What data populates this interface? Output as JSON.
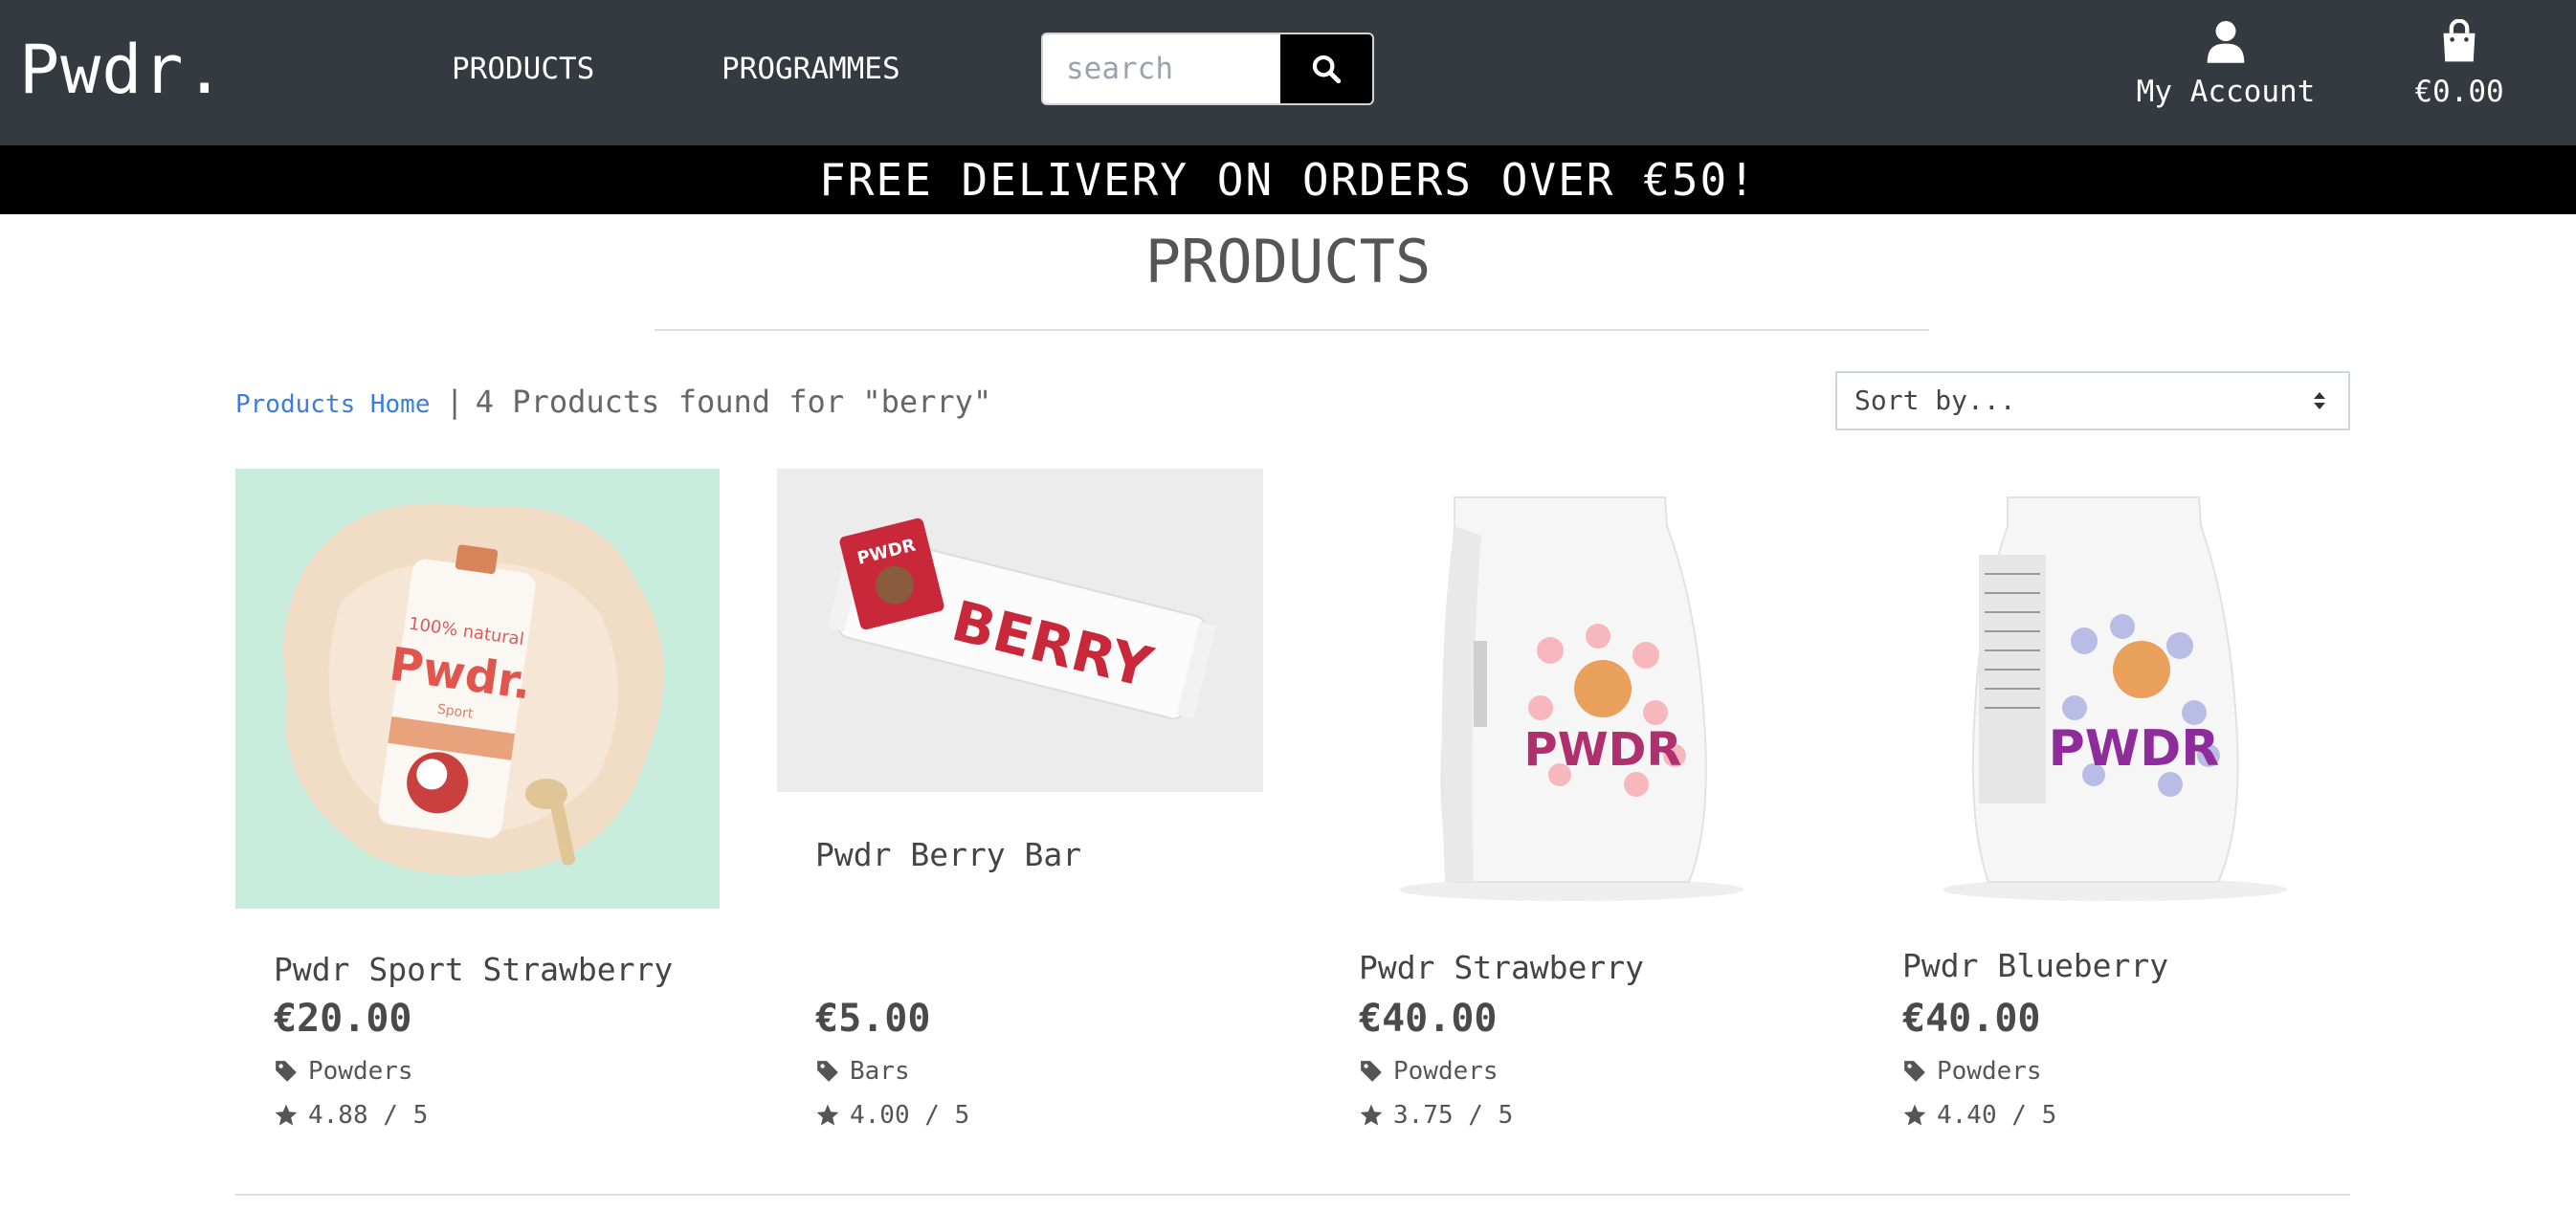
{
  "brand": "Pwdr.",
  "nav": {
    "products": "PRODUCTS",
    "programmes": "PROGRAMMES"
  },
  "search": {
    "placeholder": "search",
    "value": ""
  },
  "account": {
    "label": "My Account",
    "icon": "user-icon"
  },
  "cart": {
    "total": "€0.00",
    "icon": "shopping-bag-icon"
  },
  "banner": "FREE DELIVERY ON ORDERS OVER €50!",
  "page_title": "PRODUCTS",
  "results": {
    "home_link": "Products Home",
    "separator": "|",
    "count_text": "4 Products found for \"berry\""
  },
  "sort": {
    "selected": "Sort by..."
  },
  "products": [
    {
      "name": "Pwdr Sport Strawberry",
      "price": "€20.00",
      "category": "Powders",
      "rating": "4.88 / 5"
    },
    {
      "name": "Pwdr Berry Bar",
      "price": "€5.00",
      "category": "Bars",
      "rating": "4.00 / 5",
      "package_text": "BERRY",
      "logo_text": "PWDR"
    },
    {
      "name": "Pwdr Strawberry",
      "price": "€40.00",
      "category": "Powders",
      "rating": "3.75 / 5",
      "package_text": "PWDR"
    },
    {
      "name": "Pwdr Blueberry",
      "price": "€40.00",
      "category": "Powders",
      "rating": "4.40 / 5",
      "package_text": "PWDR"
    }
  ],
  "colors": {
    "navbar": "#343a40",
    "banner": "#000000",
    "link": "#3b7ddd",
    "berry_red": "#c8283a",
    "pwdr_purple": "#9a2f9e"
  }
}
